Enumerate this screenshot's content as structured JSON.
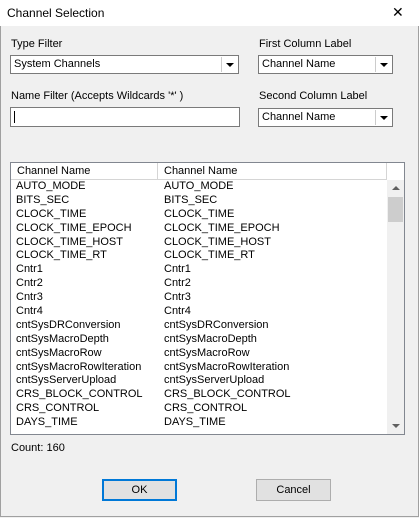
{
  "window": {
    "title": "Channel Selection",
    "close_glyph": "✕"
  },
  "type_filter": {
    "label": "Type Filter",
    "value": "System Channels"
  },
  "first_column": {
    "label": "First Column Label",
    "value": "Channel Name"
  },
  "name_filter": {
    "label": "Name Filter (Accepts Wildcards '*' )",
    "value": ""
  },
  "second_column": {
    "label": "Second Column Label",
    "value": "Channel Name"
  },
  "list": {
    "headers": [
      "Channel Name",
      "Channel Name"
    ],
    "rows": [
      [
        "AUTO_MODE",
        "AUTO_MODE"
      ],
      [
        "BITS_SEC",
        "BITS_SEC"
      ],
      [
        "CLOCK_TIME",
        "CLOCK_TIME"
      ],
      [
        "CLOCK_TIME_EPOCH",
        "CLOCK_TIME_EPOCH"
      ],
      [
        "CLOCK_TIME_HOST",
        "CLOCK_TIME_HOST"
      ],
      [
        "CLOCK_TIME_RT",
        "CLOCK_TIME_RT"
      ],
      [
        "Cntr1",
        "Cntr1"
      ],
      [
        "Cntr2",
        "Cntr2"
      ],
      [
        "Cntr3",
        "Cntr3"
      ],
      [
        "Cntr4",
        "Cntr4"
      ],
      [
        "cntSysDRConversion",
        "cntSysDRConversion"
      ],
      [
        "cntSysMacroDepth",
        "cntSysMacroDepth"
      ],
      [
        "cntSysMacroRow",
        "cntSysMacroRow"
      ],
      [
        "cntSysMacroRowIteration",
        "cntSysMacroRowIteration"
      ],
      [
        "cntSysServerUpload",
        "cntSysServerUpload"
      ],
      [
        "CRS_BLOCK_CONTROL",
        "CRS_BLOCK_CONTROL"
      ],
      [
        "CRS_CONTROL",
        "CRS_CONTROL"
      ],
      [
        "DAYS_TIME",
        "DAYS_TIME"
      ]
    ]
  },
  "count": "Count: 160",
  "buttons": {
    "ok": "OK",
    "cancel": "Cancel"
  }
}
